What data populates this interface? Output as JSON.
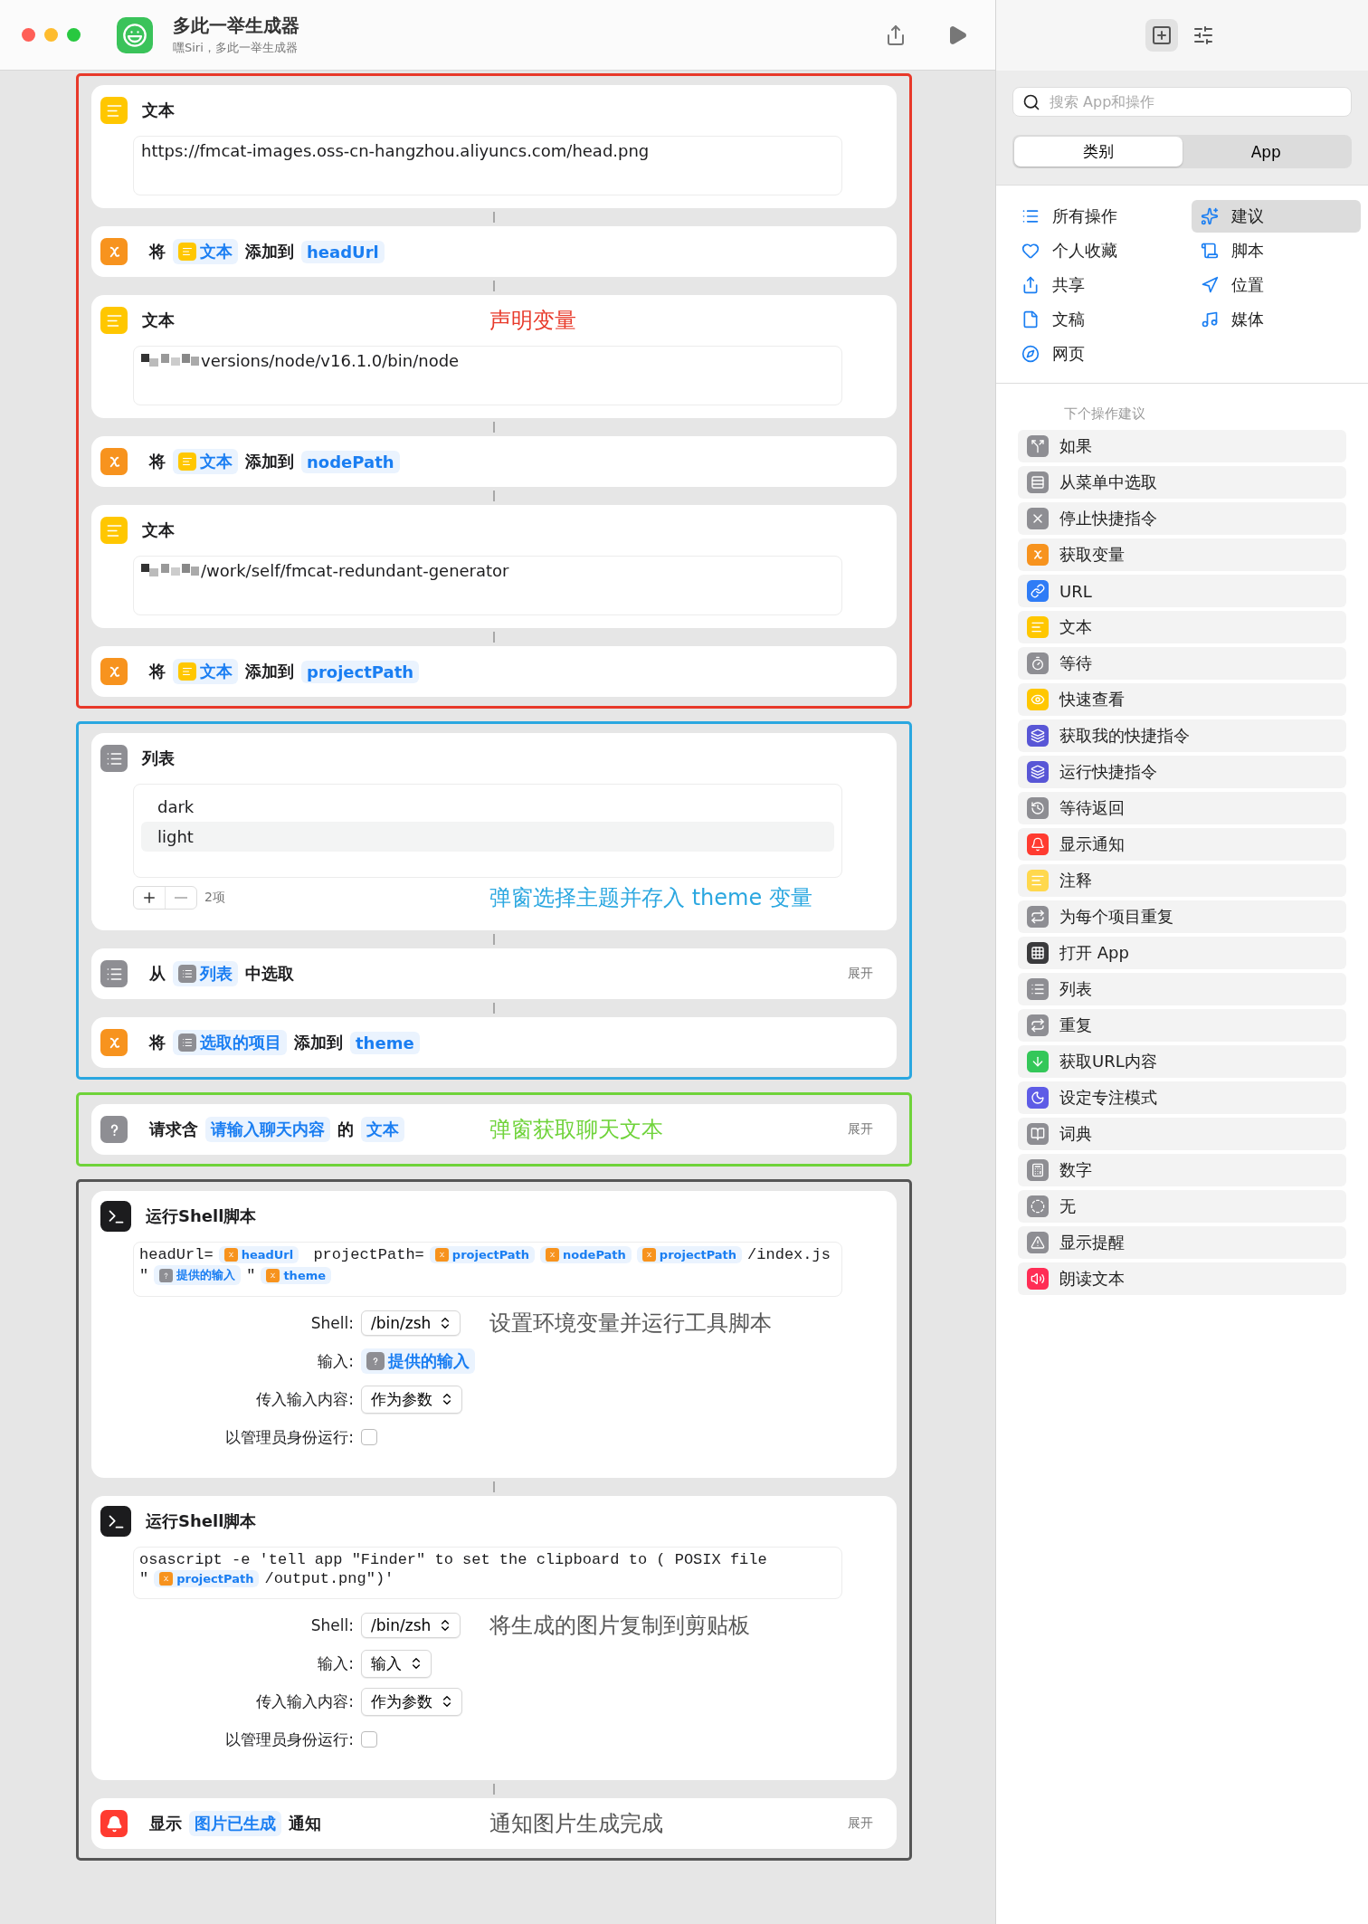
{
  "window": {
    "title": "多此一举生成器",
    "subtitle": "嘿Siri，多此一举生成器"
  },
  "groups": [
    {
      "color": "#e8392a",
      "actions": [
        {
          "kind": "text",
          "title": "文本",
          "redacted": false,
          "value": "https://fmcat-images.oss-cn-hangzhou.aliyuncs.com/head.png"
        },
        {
          "kind": "set_variable",
          "parts": [
            {
              "kind": "word",
              "text": "将"
            },
            {
              "kind": "text_ref",
              "text": "文本"
            },
            {
              "kind": "word",
              "text": "添加到"
            },
            {
              "kind": "name_ref",
              "text": "headUrl"
            }
          ]
        },
        {
          "kind": "text",
          "title": "文本",
          "note": "声明变量",
          "redacted": true,
          "value": "versions/node/v16.1.0/bin/node"
        },
        {
          "kind": "set_variable",
          "parts": [
            {
              "kind": "word",
              "text": "将"
            },
            {
              "kind": "text_ref",
              "text": "文本"
            },
            {
              "kind": "word",
              "text": "添加到"
            },
            {
              "kind": "name_ref",
              "text": "nodePath"
            }
          ]
        },
        {
          "kind": "text",
          "title": "文本",
          "redacted": true,
          "value": "/work/self/fmcat-redundant-generator"
        },
        {
          "kind": "set_variable",
          "parts": [
            {
              "kind": "word",
              "text": "将"
            },
            {
              "kind": "text_ref",
              "text": "文本"
            },
            {
              "kind": "word",
              "text": "添加到"
            },
            {
              "kind": "name_ref",
              "text": "projectPath"
            }
          ]
        }
      ]
    },
    {
      "color": "#2aa7e0",
      "actions": [
        {
          "kind": "list",
          "title": "列表",
          "items": [
            "dark",
            "light"
          ],
          "count": "2项",
          "note": "弹窗选择主题并存入 theme 变量"
        },
        {
          "kind": "choose",
          "expand": "展开",
          "parts": [
            {
              "kind": "word",
              "text": "从"
            },
            {
              "kind": "list_ref",
              "text": "列表"
            },
            {
              "kind": "word",
              "text": "中选取"
            }
          ]
        },
        {
          "kind": "set_variable",
          "parts": [
            {
              "kind": "word",
              "text": "将"
            },
            {
              "kind": "list_ref",
              "text": "选取的项目"
            },
            {
              "kind": "word",
              "text": "添加到"
            },
            {
              "kind": "name_ref",
              "text": "theme"
            }
          ]
        }
      ]
    },
    {
      "color": "#6fd33a",
      "actions": [
        {
          "kind": "ask",
          "expand": "展开",
          "note": "弹窗获取聊天文本",
          "parts": [
            {
              "kind": "word",
              "text": "请求含"
            },
            {
              "kind": "name_ref",
              "text": "请输入聊天内容"
            },
            {
              "kind": "word",
              "text": "的"
            },
            {
              "kind": "name_ref",
              "text": "文本"
            }
          ]
        }
      ]
    },
    {
      "color": "#555555",
      "actions": [
        {
          "kind": "shell",
          "title": "运行Shell脚本",
          "note": "设置环境变量并运行工具脚本",
          "code": [
            [
              {
                "kind": "code",
                "text": "headUrl="
              },
              {
                "kind": "var_ref",
                "text": "headUrl"
              },
              {
                "kind": "code",
                "text": " projectPath="
              },
              {
                "kind": "var_ref",
                "text": "projectPath"
              },
              {
                "kind": "var_ref",
                "text": "nodePath"
              },
              {
                "kind": "var_ref",
                "text": "projectPath"
              },
              {
                "kind": "code",
                "text": "/index.js"
              }
            ],
            [
              {
                "kind": "code",
                "text": "\""
              },
              {
                "kind": "ask_ref",
                "text": "提供的输入"
              },
              {
                "kind": "code",
                "text": "\""
              },
              {
                "kind": "var_ref",
                "text": "theme"
              }
            ]
          ],
          "fields": [
            {
              "kind": "popup",
              "label": "Shell:",
              "value": "/bin/zsh"
            },
            {
              "kind": "ask_ref",
              "label": "输入:",
              "value": "提供的输入"
            },
            {
              "kind": "popup",
              "label": "传入输入内容:",
              "value": "作为参数"
            },
            {
              "kind": "checkbox",
              "label": "以管理员身份运行:",
              "checked": false
            }
          ]
        },
        {
          "kind": "shell",
          "title": "运行Shell脚本",
          "note": "将生成的图片复制到剪贴板",
          "code": [
            [
              {
                "kind": "code",
                "text": "osascript -e 'tell app \"Finder\" to set the clipboard to ( POSIX file"
              }
            ],
            [
              {
                "kind": "code",
                "text": "\""
              },
              {
                "kind": "var_ref",
                "text": "projectPath"
              },
              {
                "kind": "code",
                "text": "/output.png\")'"
              }
            ]
          ],
          "fields": [
            {
              "kind": "popup",
              "label": "Shell:",
              "value": "/bin/zsh"
            },
            {
              "kind": "popup",
              "label": "输入:",
              "value": "输入"
            },
            {
              "kind": "popup",
              "label": "传入输入内容:",
              "value": "作为参数"
            },
            {
              "kind": "checkbox",
              "label": "以管理员身份运行:",
              "checked": false
            }
          ]
        },
        {
          "kind": "notify",
          "expand": "展开",
          "note": "通知图片生成完成",
          "parts": [
            {
              "kind": "word",
              "text": "显示"
            },
            {
              "kind": "name_ref",
              "text": "图片已生成"
            },
            {
              "kind": "word",
              "text": "通知"
            }
          ]
        }
      ]
    }
  ],
  "sidebar": {
    "panel_tabs": [
      {
        "selected": true
      },
      {
        "selected": false
      }
    ],
    "search": {
      "placeholder": "搜索 App和操作"
    },
    "segments": [
      {
        "label": "类别",
        "selected": true
      },
      {
        "label": "App",
        "selected": false
      }
    ],
    "categories": [
      {
        "label": "所有操作",
        "selected": false
      },
      {
        "label": "建议",
        "selected": true
      },
      {
        "label": "个人收藏",
        "selected": false
      },
      {
        "label": "脚本",
        "selected": false
      },
      {
        "label": "共享",
        "selected": false
      },
      {
        "label": "位置",
        "selected": false
      },
      {
        "label": "文稿",
        "selected": false
      },
      {
        "label": "媒体",
        "selected": false
      },
      {
        "label": "网页",
        "selected": false
      }
    ],
    "suggestions_title": "下个操作建议",
    "suggestions": [
      {
        "label": "如果",
        "color": "#8e8e93"
      },
      {
        "label": "从菜单中选取",
        "color": "#8e8e93"
      },
      {
        "label": "停止快捷指令",
        "color": "#8e8e93"
      },
      {
        "label": "获取变量",
        "color": "#f7931e"
      },
      {
        "label": "URL",
        "color": "#2f7cf6"
      },
      {
        "label": "文本",
        "color": "#ffc700"
      },
      {
        "label": "等待",
        "color": "#8e8e93"
      },
      {
        "label": "快速查看",
        "color": "#ffc700"
      },
      {
        "label": "获取我的快捷指令",
        "color": "#5856d6"
      },
      {
        "label": "运行快捷指令",
        "color": "#5856d6"
      },
      {
        "label": "等待返回",
        "color": "#8e8e93"
      },
      {
        "label": "显示通知",
        "color": "#ff3b30"
      },
      {
        "label": "注释",
        "color": "#ffd84d"
      },
      {
        "label": "为每个项目重复",
        "color": "#8e8e93"
      },
      {
        "label": "打开 App",
        "color": "#3a3a3c"
      },
      {
        "label": "列表",
        "color": "#8e8e93"
      },
      {
        "label": "重复",
        "color": "#8e8e93"
      },
      {
        "label": "获取URL内容",
        "color": "#34c759"
      },
      {
        "label": "设定专注模式",
        "color": "#5e5ce6"
      },
      {
        "label": "词典",
        "color": "#8e8e93"
      },
      {
        "label": "数字",
        "color": "#8e8e93"
      },
      {
        "label": "无",
        "color": "#8e8e93"
      },
      {
        "label": "显示提醒",
        "color": "#8e8e93"
      },
      {
        "label": "朗读文本",
        "color": "#ff2d55"
      }
    ]
  }
}
